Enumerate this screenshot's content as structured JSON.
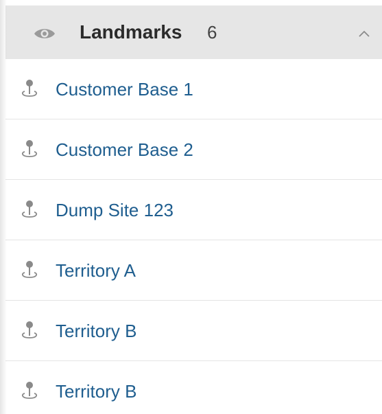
{
  "header": {
    "title": "Landmarks",
    "count": "6",
    "icon": "eye-icon",
    "collapse_icon": "chevron-up-icon"
  },
  "items": [
    {
      "label": "Customer Base 1",
      "icon": "map-pin-icon"
    },
    {
      "label": "Customer Base 2",
      "icon": "map-pin-icon"
    },
    {
      "label": "Dump Site 123",
      "icon": "map-pin-icon"
    },
    {
      "label": "Territory A",
      "icon": "map-pin-icon"
    },
    {
      "label": "Territory B",
      "icon": "map-pin-icon"
    },
    {
      "label": "Territory B",
      "icon": "map-pin-icon"
    }
  ],
  "colors": {
    "header_bg": "#e6e6e6",
    "item_text": "#1f5e8f",
    "title_text": "#2b2b2b",
    "icon_gray": "#9a9a9a"
  }
}
